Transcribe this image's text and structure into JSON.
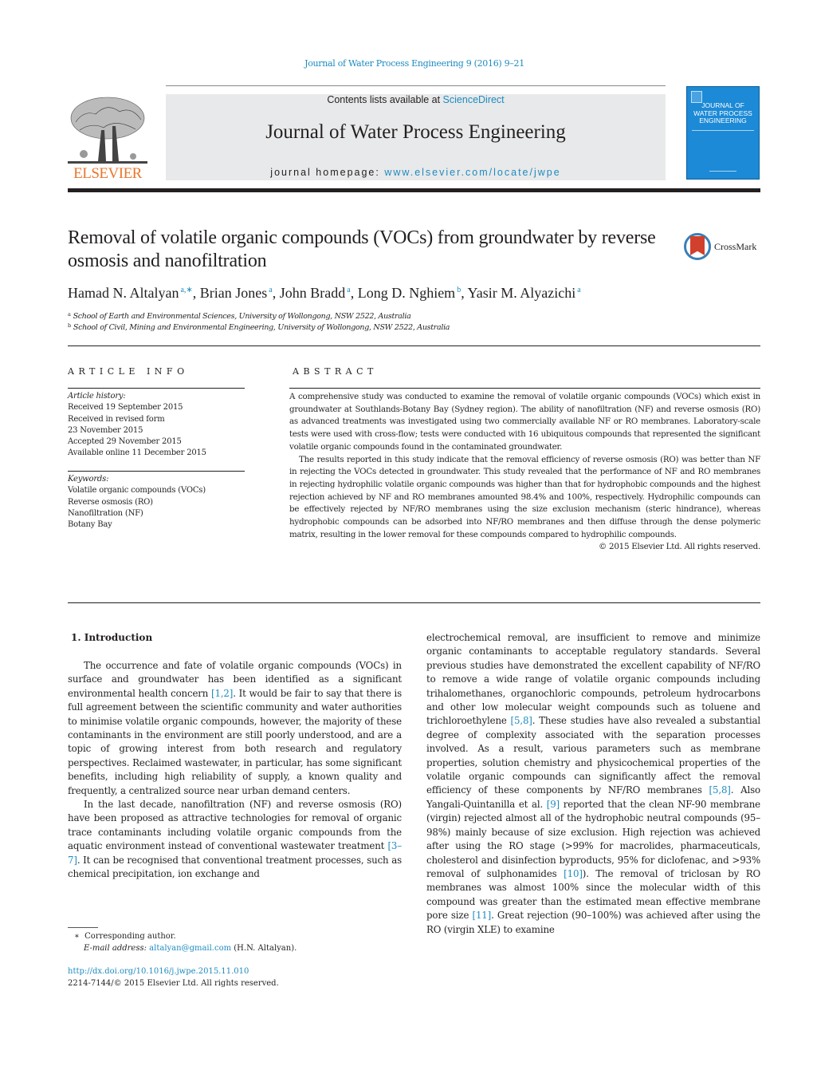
{
  "header": {
    "journal_reference": "Journal of Water Process Engineering 9 (2016) 9–21",
    "contents_prefix": "Contents lists available at ",
    "contents_link": "ScienceDirect",
    "journal_name": "Journal of Water Process Engineering",
    "homepage_prefix": "journal homepage: ",
    "homepage_link": "www.elsevier.com/locate/jwpe",
    "publisher_logo_text": "ELSEVIER",
    "cover": {
      "title_line1": "JOURNAL OF",
      "title_line2": "WATER PROCESS",
      "title_line3": "ENGINEERING"
    },
    "colors": {
      "link": "#1e8bbf",
      "publisher_orange": "#e8772e",
      "cover_blue": "#1c8ad6",
      "banner_gray": "#e8e9ea"
    }
  },
  "article": {
    "title": "Removal of volatile organic compounds (VOCs) from groundwater by reverse osmosis and nanofiltration",
    "crossmark_label": "CrossMark",
    "authors": [
      {
        "name": "Hamad N. Altalyan",
        "sup": "a,∗",
        "sep": ", "
      },
      {
        "name": "Brian Jones",
        "sup": "a",
        "sep": ", "
      },
      {
        "name": "John Bradd",
        "sup": "a",
        "sep": ", "
      },
      {
        "name": "Long D. Nghiem",
        "sup": "b",
        "sep": ", "
      },
      {
        "name": "Yasir M. Alyazichi",
        "sup": "a",
        "sep": ""
      }
    ],
    "affiliations": [
      {
        "mark": "a",
        "text": "School of Earth and Environmental Sciences, University of Wollongong, NSW 2522, Australia"
      },
      {
        "mark": "b",
        "text": "School of Civil, Mining and Environmental Engineering, University of Wollongong, NSW 2522, Australia"
      }
    ]
  },
  "article_info": {
    "heading": "ARTICLE INFO",
    "history_label": "Article history:",
    "history": [
      "Received 19 September 2015",
      "Received in revised form",
      "23 November 2015",
      "Accepted 29 November 2015",
      "Available online 11 December 2015"
    ],
    "keywords_label": "Keywords:",
    "keywords": [
      "Volatile organic compounds (VOCs)",
      "Reverse osmosis (RO)",
      "Nanofiltration (NF)",
      "Botany Bay"
    ]
  },
  "abstract": {
    "heading": "ABSTRACT",
    "paragraphs": [
      "A comprehensive study was conducted to examine the removal of volatile organic compounds (VOCs) which exist in groundwater at Southlands-Botany Bay (Sydney region). The ability of nanofiltration (NF) and reverse osmosis (RO) as advanced treatments was investigated using two commercially available NF or RO membranes. Laboratory-scale tests were used with cross-flow; tests were conducted with 16 ubiquitous compounds that represented the significant volatile organic compounds found in the contaminated groundwater.",
      "The results reported in this study indicate that the removal efficiency of reverse osmosis (RO) was better than NF in rejecting the VOCs detected in groundwater. This study revealed that the performance of NF and RO membranes in rejecting hydrophilic volatile organic compounds was higher than that for hydrophobic compounds and the highest rejection achieved by NF and RO membranes amounted 98.4% and 100%, respectively. Hydrophilic compounds can be effectively rejected by NF/RO membranes using the size exclusion mechanism (steric hindrance), whereas hydrophobic compounds can be adsorbed into NF/RO membranes and then diffuse through the dense polymeric matrix, resulting in the lower removal for these compounds compared to hydrophilic compounds."
    ],
    "copyright": "© 2015 Elsevier Ltd. All rights reserved."
  },
  "body": {
    "section_heading": "1.  Introduction",
    "left_column": {
      "p1": {
        "t1": "The occurrence and fate of volatile organic compounds (VOCs) in surface and groundwater has been identified as a significant environmental health concern ",
        "ref1": "[1,2]",
        "t2": ". It would be fair to say that there is full agreement between the scientific community and water authorities to minimise volatile organic compounds, however, the majority of these contaminants in the environment are still poorly understood, and are a topic of growing interest from both research and regulatory perspectives. Reclaimed wastewater, in particular, has some significant benefits, including high reliability of supply, a known quality and frequently, a centralized source near urban demand centers."
      },
      "p2": {
        "t1": "In the last decade, nanofiltration (NF) and reverse osmosis (RO) have been proposed as attractive technologies for removal of organic trace contaminants including volatile organic compounds from the aquatic environment instead of conventional wastewater treatment ",
        "ref1": "[3–7]",
        "t2": ". It can be recognised that conventional treatment processes, such as chemical precipitation, ion exchange and"
      }
    },
    "right_column": {
      "t1": "electrochemical removal, are insufficient to remove and minimize organic contaminants to acceptable regulatory standards. Several previous studies have demonstrated the excellent capability of NF/RO to remove a wide range of volatile organic compounds including trihalomethanes, organochloric compounds, petroleum hydrocarbons and other low molecular weight compounds such as toluene and trichloroethylene ",
      "ref1": "[5,8]",
      "t2": ". These studies have also revealed a substantial degree of complexity associated with the separation processes involved. As a result, various parameters such as membrane properties, solution chemistry and physicochemical properties of the volatile organic compounds can significantly affect the removal efficiency of these components by NF/RO membranes ",
      "ref2": "[5,8]",
      "t3": ". Also Yangali-Quintanilla et al. ",
      "ref3": "[9]",
      "t4": " reported that the clean NF-90 membrane (virgin) rejected almost all of the hydrophobic neutral compounds (95–98%) mainly because of size exclusion. High rejection was achieved after using the RO stage (>99% for macrolides, pharmaceuticals, cholesterol and disinfection byproducts, 95% for diclofenac, and >93% removal of sulphonamides ",
      "ref4": "[10]",
      "t5": "). The removal of triclosan by RO membranes was almost 100% since the molecular width of this compound was greater than the estimated mean effective membrane pore size ",
      "ref5": "[11]",
      "t6": ". Great rejection (90–100%) was achieved after using the RO (virgin XLE) to examine"
    }
  },
  "footnotes": {
    "corresponding_mark": "∗",
    "corresponding_text": "Corresponding author.",
    "email_label": "E-mail address:",
    "email": "altalyan@gmail.com",
    "email_suffix": " (H.N. Altalyan).",
    "doi": "http://dx.doi.org/10.1016/j.jwpe.2015.11.010",
    "issn_line": "2214-7144/© 2015 Elsevier Ltd. All rights reserved."
  }
}
